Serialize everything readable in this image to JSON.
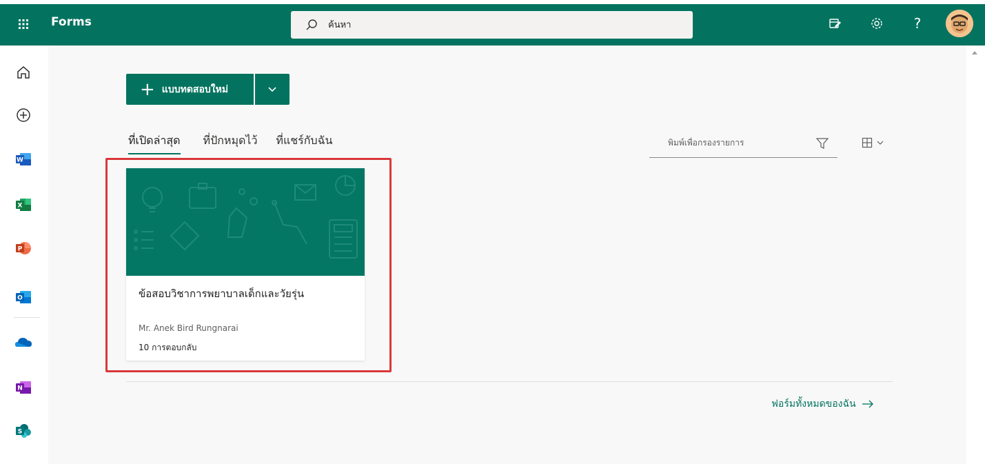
{
  "header": {
    "app_name": "Forms",
    "search_placeholder": "ค้นหา"
  },
  "toolbar": {
    "new_quiz_label": "แบบทดสอบใหม่"
  },
  "tabs": [
    {
      "label": "ที่เปิดล่าสุด",
      "active": true
    },
    {
      "label": "ที่ปักหมุดไว้",
      "active": false
    },
    {
      "label": "ที่แชร์กับฉัน",
      "active": false
    }
  ],
  "filter": {
    "placeholder": "พิมพ์เพื่อกรองรายการ"
  },
  "cards": [
    {
      "title": "ข้อสอบวิชาการพยาบาลเด็กและวัยรุ่น",
      "owner": "Mr. Anek Bird Rungnarai",
      "responses": "10 การตอบกลับ"
    }
  ],
  "footer": {
    "all_forms_link": "ฟอร์มทั้งหมดของฉัน"
  },
  "colors": {
    "brand": "#03735f",
    "highlight": "#d9373a"
  }
}
